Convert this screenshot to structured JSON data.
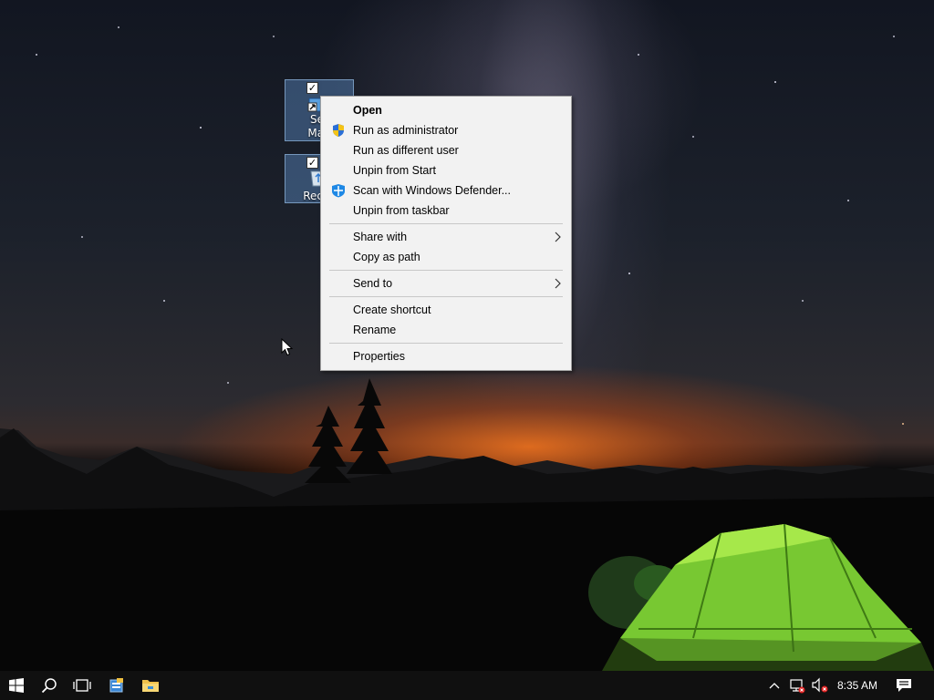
{
  "desktop": {
    "icons": [
      {
        "label": "Ser\nMan",
        "line1": "Ser",
        "line2": "Man",
        "checked": "✓"
      },
      {
        "label": "Recyc",
        "line1": "Recyc",
        "checked": "✓"
      }
    ]
  },
  "context_menu": {
    "items": [
      {
        "label": "Open",
        "bold": true
      },
      {
        "label": "Run as administrator",
        "icon": "uac-shield-icon"
      },
      {
        "label": "Run as different user"
      },
      {
        "label": "Unpin from Start"
      },
      {
        "label": "Scan with Windows Defender...",
        "icon": "windows-defender-icon"
      },
      {
        "label": "Unpin from taskbar"
      },
      {
        "label": "Share with",
        "submenu": true
      },
      {
        "label": "Copy as path"
      },
      {
        "label": "Send to",
        "submenu": true
      },
      {
        "label": "Create shortcut"
      },
      {
        "label": "Rename"
      },
      {
        "label": "Properties"
      }
    ]
  },
  "taskbar": {
    "buttons": [
      "start-icon",
      "search-icon",
      "task-view-icon",
      "server-manager-icon",
      "file-explorer-icon"
    ],
    "tray": [
      "chevron-up-icon",
      "network-icon",
      "volume-muted-icon"
    ],
    "clock": "8:35 AM",
    "notification": "action-center-icon"
  },
  "colors": {
    "menu_bg": "#f2f2f2",
    "taskbar_bg": "#101010",
    "tent_green": "#7ed321",
    "sunset": "#e06a1e"
  }
}
